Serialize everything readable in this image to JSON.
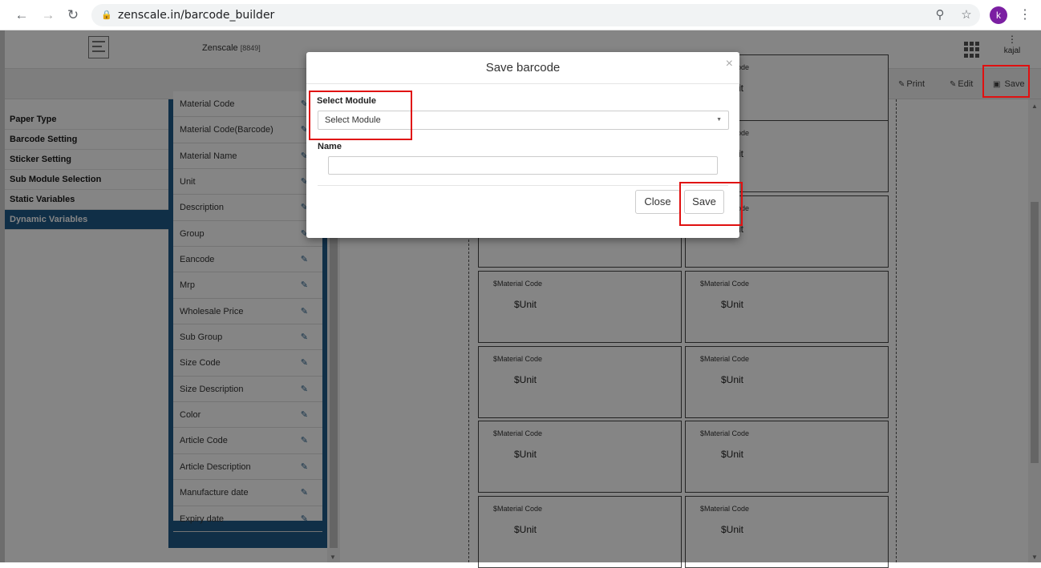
{
  "browser": {
    "url": "zenscale.in/barcode_builder",
    "profile_initial": "k"
  },
  "app": {
    "company": "Zenscale",
    "company_code": "[8849]",
    "user": "kajal"
  },
  "toolbar": {
    "print_label": "Print",
    "edit_label": "Edit",
    "save_label": "Save"
  },
  "sidebar": {
    "items": [
      {
        "label": "Paper Type"
      },
      {
        "label": "Barcode Setting"
      },
      {
        "label": "Sticker Setting"
      },
      {
        "label": "Sub Module Selection"
      },
      {
        "label": "Static Variables"
      },
      {
        "label": "Dynamic Variables"
      }
    ]
  },
  "variables": {
    "items": [
      {
        "label": "Material Code"
      },
      {
        "label": "Material Code(Barcode)"
      },
      {
        "label": "Material Name"
      },
      {
        "label": "Unit"
      },
      {
        "label": "Description"
      },
      {
        "label": "Group"
      },
      {
        "label": "Eancode"
      },
      {
        "label": "Mrp"
      },
      {
        "label": "Wholesale Price"
      },
      {
        "label": "Sub Group"
      },
      {
        "label": "Size Code"
      },
      {
        "label": "Size Description"
      },
      {
        "label": "Color"
      },
      {
        "label": "Article Code"
      },
      {
        "label": "Article Description"
      },
      {
        "label": "Manufacture date"
      },
      {
        "label": "Expiry date"
      }
    ]
  },
  "labels": {
    "code_text": "$Material Code",
    "unit_text": "$Unit"
  },
  "modal": {
    "title": "Save barcode",
    "close_symbol": "×",
    "module_label": "Select Module",
    "module_selected": "Select Module",
    "name_label": "Name",
    "name_value": "",
    "close_button": "Close",
    "save_button": "Save"
  },
  "colors": {
    "accent": "#1f5a88",
    "highlight": "#e01010",
    "avatar": "#7b1fa2"
  }
}
